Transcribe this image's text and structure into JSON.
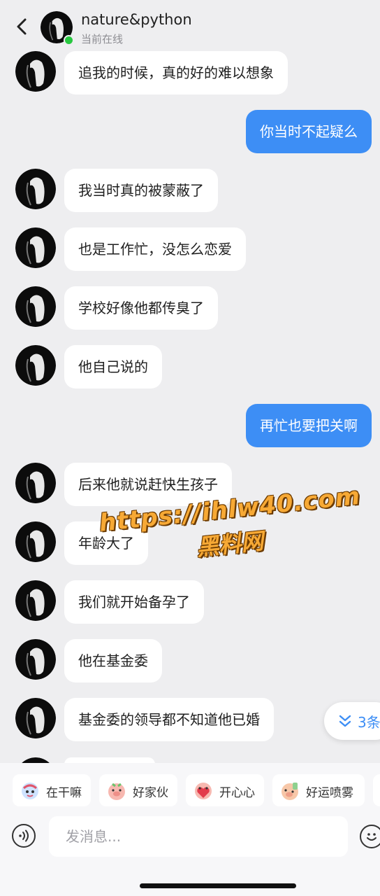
{
  "header": {
    "contact_name": "nature&python",
    "status": "当前在线"
  },
  "messages": [
    {
      "side": "in",
      "text": "追我的时候，真的好的难以想象"
    },
    {
      "side": "out",
      "text": "你当时不起疑么"
    },
    {
      "side": "in",
      "text": "我当时真的被蒙蔽了"
    },
    {
      "side": "in",
      "text": "也是工作忙，没怎么恋爱"
    },
    {
      "side": "in",
      "text": "学校好像他都传臭了"
    },
    {
      "side": "in",
      "text": "他自己说的"
    },
    {
      "side": "out",
      "text": "再忙也要把关啊"
    },
    {
      "side": "in",
      "text": "后来他就说赶快生孩子"
    },
    {
      "side": "in",
      "text": "年龄大了"
    },
    {
      "side": "in",
      "text": "我们就开始备孕了"
    },
    {
      "side": "in",
      "text": "他在基金委"
    },
    {
      "side": "in",
      "text": "基金委的领导都不知道他已婚"
    }
  ],
  "watermark": {
    "url": "https://ihlw40.com",
    "site_name": "黑料网"
  },
  "unread": {
    "label": "3条"
  },
  "quick_replies": [
    {
      "label": "在干嘛",
      "icon": "wave-sticker-icon"
    },
    {
      "label": "好家伙",
      "icon": "pig-sticker-icon"
    },
    {
      "label": "开心心",
      "icon": "pig-heart-sticker-icon"
    },
    {
      "label": "好运喷雾",
      "icon": "pig-spray-sticker-icon"
    }
  ],
  "composer": {
    "placeholder": "发消息..."
  },
  "colors": {
    "outgoing_bubble": "#3d8ef5",
    "incoming_bubble": "#ffffff",
    "online_dot": "#28c840",
    "background": "#eeeef0"
  }
}
